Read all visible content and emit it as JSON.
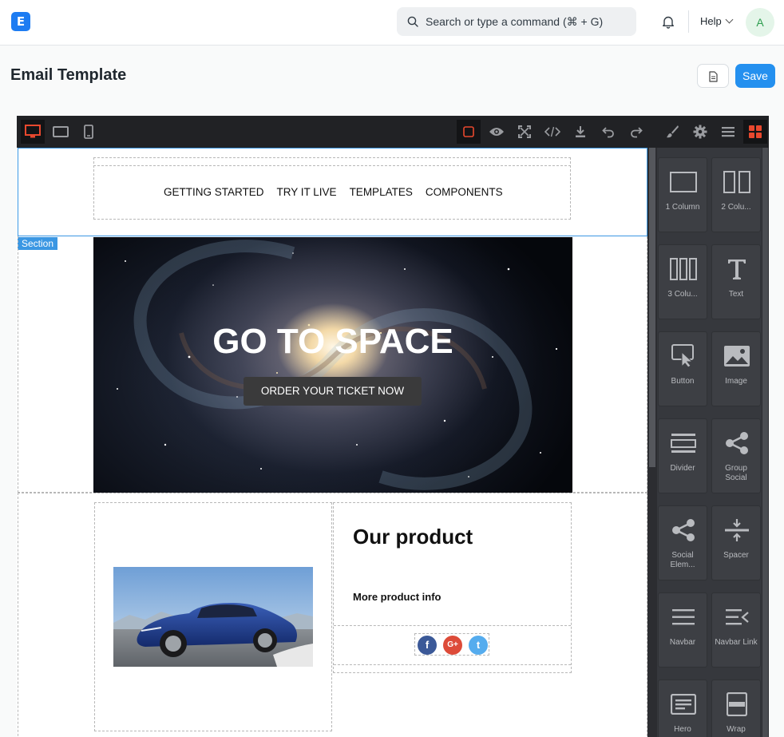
{
  "app": {
    "logo_letter": "E"
  },
  "search": {
    "placeholder": "Search or type a command (⌘ + G)"
  },
  "help": {
    "label": "Help"
  },
  "user": {
    "initial": "A"
  },
  "page": {
    "title": "Email Template",
    "save_label": "Save"
  },
  "section_badge": "Section",
  "navbar": {
    "links": [
      "GETTING STARTED",
      "TRY IT LIVE",
      "TEMPLATES",
      "COMPONENTS"
    ]
  },
  "hero": {
    "title": "GO TO SPACE",
    "button": "ORDER YOUR TICKET NOW"
  },
  "product": {
    "title": "Our product",
    "subtitle": "More product info"
  },
  "social": [
    "f",
    "G+",
    "t"
  ],
  "blocks": [
    {
      "label": "1 Column",
      "icon": "one-column-icon"
    },
    {
      "label": "2 Colu...",
      "icon": "two-column-icon"
    },
    {
      "label": "3 Colu...",
      "icon": "three-column-icon"
    },
    {
      "label": "Text",
      "icon": "text-icon"
    },
    {
      "label": "Button",
      "icon": "button-icon"
    },
    {
      "label": "Image",
      "icon": "image-icon"
    },
    {
      "label": "Divider",
      "icon": "divider-icon"
    },
    {
      "label": "Group Social",
      "icon": "share-icon"
    },
    {
      "label": "Social Elem...",
      "icon": "share-icon"
    },
    {
      "label": "Spacer",
      "icon": "spacer-icon"
    },
    {
      "label": "Navbar",
      "icon": "navbar-icon"
    },
    {
      "label": "Navbar Link",
      "icon": "navbar-link-icon"
    },
    {
      "label": "Hero",
      "icon": "hero-icon"
    },
    {
      "label": "Wrap",
      "icon": "wrap-icon"
    }
  ],
  "colors": {
    "accent": "#2490ef",
    "toolbar": "#212225",
    "active_red": "#e8482e",
    "panel": "#36383d"
  }
}
